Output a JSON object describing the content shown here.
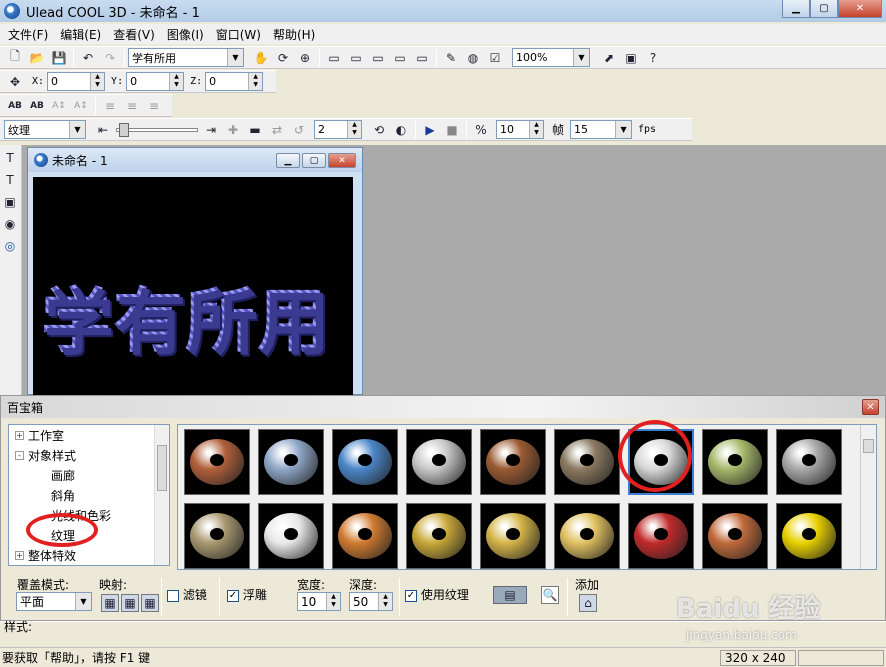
{
  "window": {
    "title": "Ulead COOL 3D - 未命名 - 1"
  },
  "menu": [
    "文件(F)",
    "编辑(E)",
    "查看(V)",
    "图像(I)",
    "窗口(W)",
    "帮助(H)"
  ],
  "toolbar1": {
    "text_combo": "学有所用",
    "zoom": "100%"
  },
  "toolbar2": {
    "x_label": "X:",
    "y_label": "Y:",
    "z_label": "Z:",
    "x": "0",
    "y": "0",
    "z": "0"
  },
  "toolbar4": {
    "mode_combo": "纹理",
    "frame_step": "2",
    "frame": "10",
    "frame_label": "帧",
    "fps_combo": "15",
    "fps_label": "fps"
  },
  "document": {
    "title": "未命名 - 1",
    "canvas_text": "学有所用"
  },
  "palette": {
    "title": "百宝箱",
    "tree": [
      {
        "label": "工作室",
        "expander": "+",
        "level": 0
      },
      {
        "label": "对象样式",
        "expander": "-",
        "level": 0
      },
      {
        "label": "画廊",
        "level": 1
      },
      {
        "label": "斜角",
        "level": 1
      },
      {
        "label": "光线和色彩",
        "level": 1
      },
      {
        "label": "纹理",
        "level": 1
      },
      {
        "label": "整体特效",
        "expander": "+",
        "level": 0
      }
    ],
    "thumbnails": [
      {
        "name": "brick-red",
        "color": "#b0603a"
      },
      {
        "name": "metal-blue-pattern",
        "color": "#8fa7c8"
      },
      {
        "name": "blue-rough",
        "color": "#4a86c8"
      },
      {
        "name": "white-brick",
        "color": "#c8c8c8"
      },
      {
        "name": "wood-bark",
        "color": "#9a5a32"
      },
      {
        "name": "stone-rock",
        "color": "#8a7a60"
      },
      {
        "name": "white-crackle",
        "color": "#d8d8d8"
      },
      {
        "name": "green-moss",
        "color": "#a6b86a"
      },
      {
        "name": "gray-marble",
        "color": "#a8a8a8"
      },
      {
        "name": "sand-fabric",
        "color": "#a89870"
      },
      {
        "name": "silver-white",
        "color": "#e8e8e8"
      },
      {
        "name": "copper-orange",
        "color": "#d07a30"
      },
      {
        "name": "gold",
        "color": "#c8a838"
      },
      {
        "name": "gold-bright",
        "color": "#d4b448"
      },
      {
        "name": "gold-shiny",
        "color": "#e0c060"
      },
      {
        "name": "red-brick-tile",
        "color": "#c02a2a"
      },
      {
        "name": "terracotta",
        "color": "#c06a3a"
      },
      {
        "name": "yellow",
        "color": "#e8d000"
      }
    ],
    "controls": {
      "cover_mode_label": "覆盖模式:",
      "cover_mode_value": "平面",
      "mapping_label": "映射:",
      "filter_label": "滤镜",
      "filter_checked": false,
      "emboss_label": "浮雕",
      "emboss_checked": true,
      "width_label": "宽度:",
      "width_value": "10",
      "depth_label": "深度:",
      "depth_value": "50",
      "use_texture_label": "使用纹理",
      "use_texture_checked": true,
      "add_label": "添加"
    }
  },
  "status": {
    "line1": "样式:",
    "hint": "要获取「帮助」，请按 F1 键",
    "size": "320 x 240"
  },
  "watermark": {
    "main": "Baidu 经验",
    "sub": "jingyan.baidu.com"
  },
  "colors": {
    "highlight": "#e32020",
    "selection": "#3b7fd0"
  }
}
